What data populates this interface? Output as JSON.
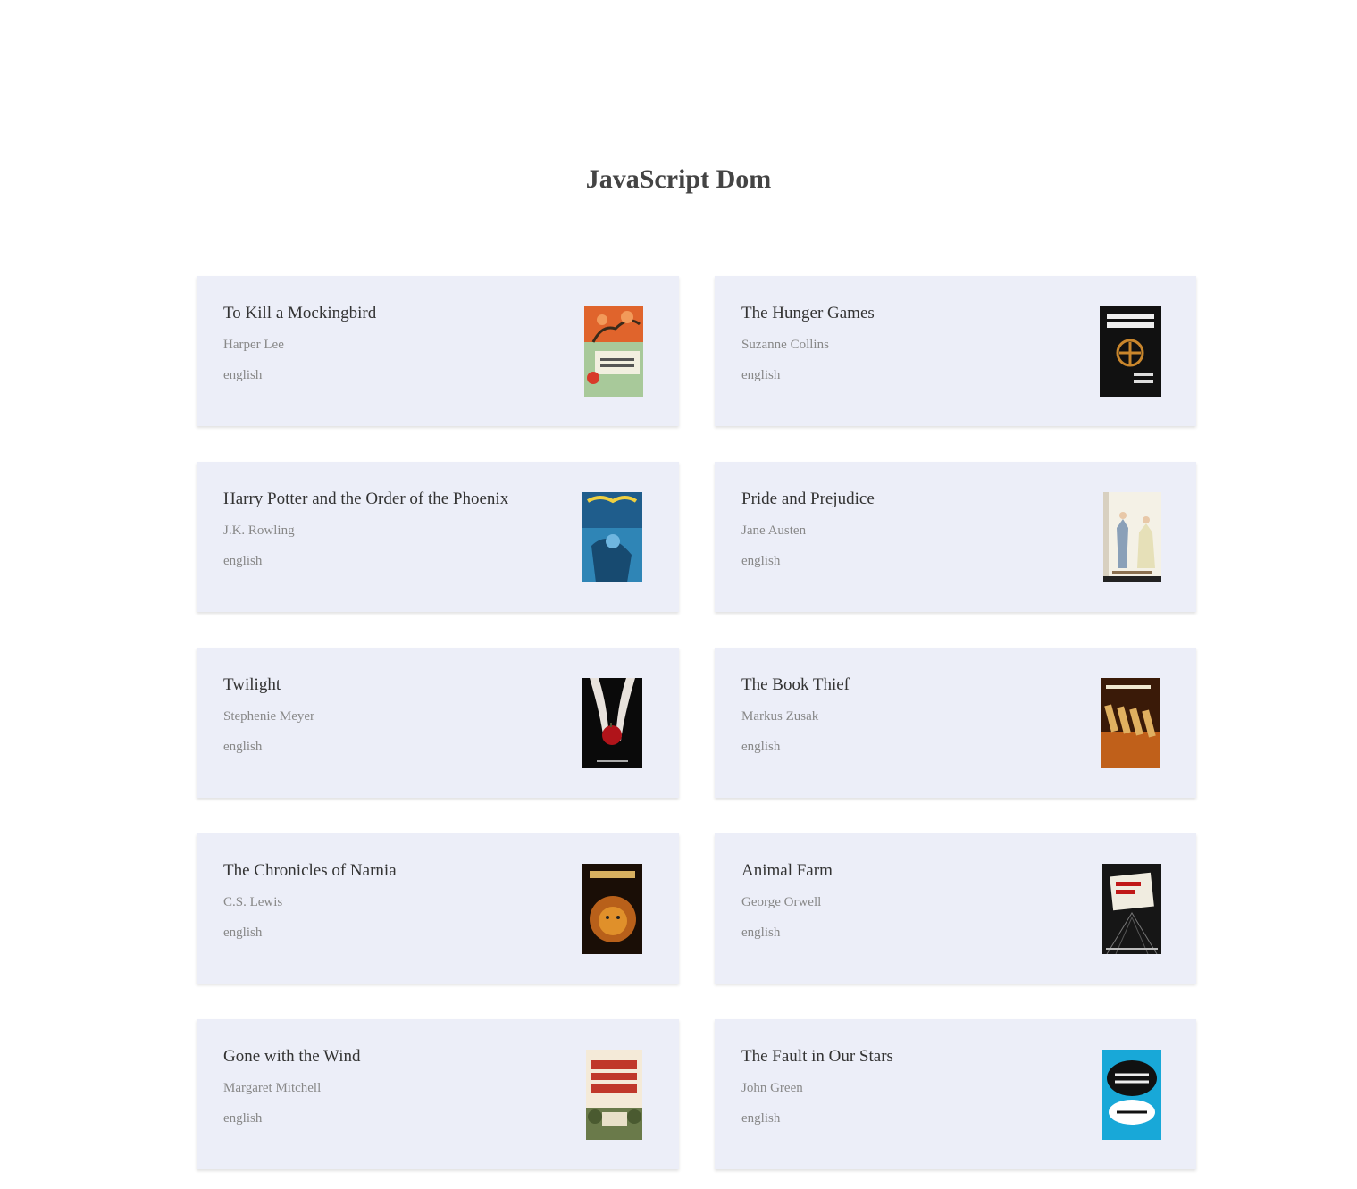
{
  "page": {
    "title": "JavaScript Dom"
  },
  "books": [
    {
      "title": "To Kill a Mockingbird",
      "author": "Harper Lee",
      "language": "english",
      "cover": "mockingbird-cover"
    },
    {
      "title": "The Hunger Games",
      "author": "Suzanne Collins",
      "language": "english",
      "cover": "hunger-games-cover"
    },
    {
      "title": "Harry Potter and the Order of the Phoenix",
      "author": "J.K. Rowling",
      "language": "english",
      "cover": "harry-potter-cover"
    },
    {
      "title": "Pride and Prejudice",
      "author": "Jane Austen",
      "language": "english",
      "cover": "pride-prejudice-cover"
    },
    {
      "title": "Twilight",
      "author": "Stephenie Meyer",
      "language": "english",
      "cover": "twilight-cover"
    },
    {
      "title": "The Book Thief",
      "author": "Markus Zusak",
      "language": "english",
      "cover": "book-thief-cover"
    },
    {
      "title": "The Chronicles of Narnia",
      "author": "C.S. Lewis",
      "language": "english",
      "cover": "narnia-cover"
    },
    {
      "title": "Animal Farm",
      "author": "George Orwell",
      "language": "english",
      "cover": "animal-farm-cover"
    },
    {
      "title": "Gone with the Wind",
      "author": "Margaret Mitchell",
      "language": "english",
      "cover": "gone-wind-cover"
    },
    {
      "title": "The Fault in Our Stars",
      "author": "John Green",
      "language": "english",
      "cover": "fault-stars-cover"
    }
  ]
}
